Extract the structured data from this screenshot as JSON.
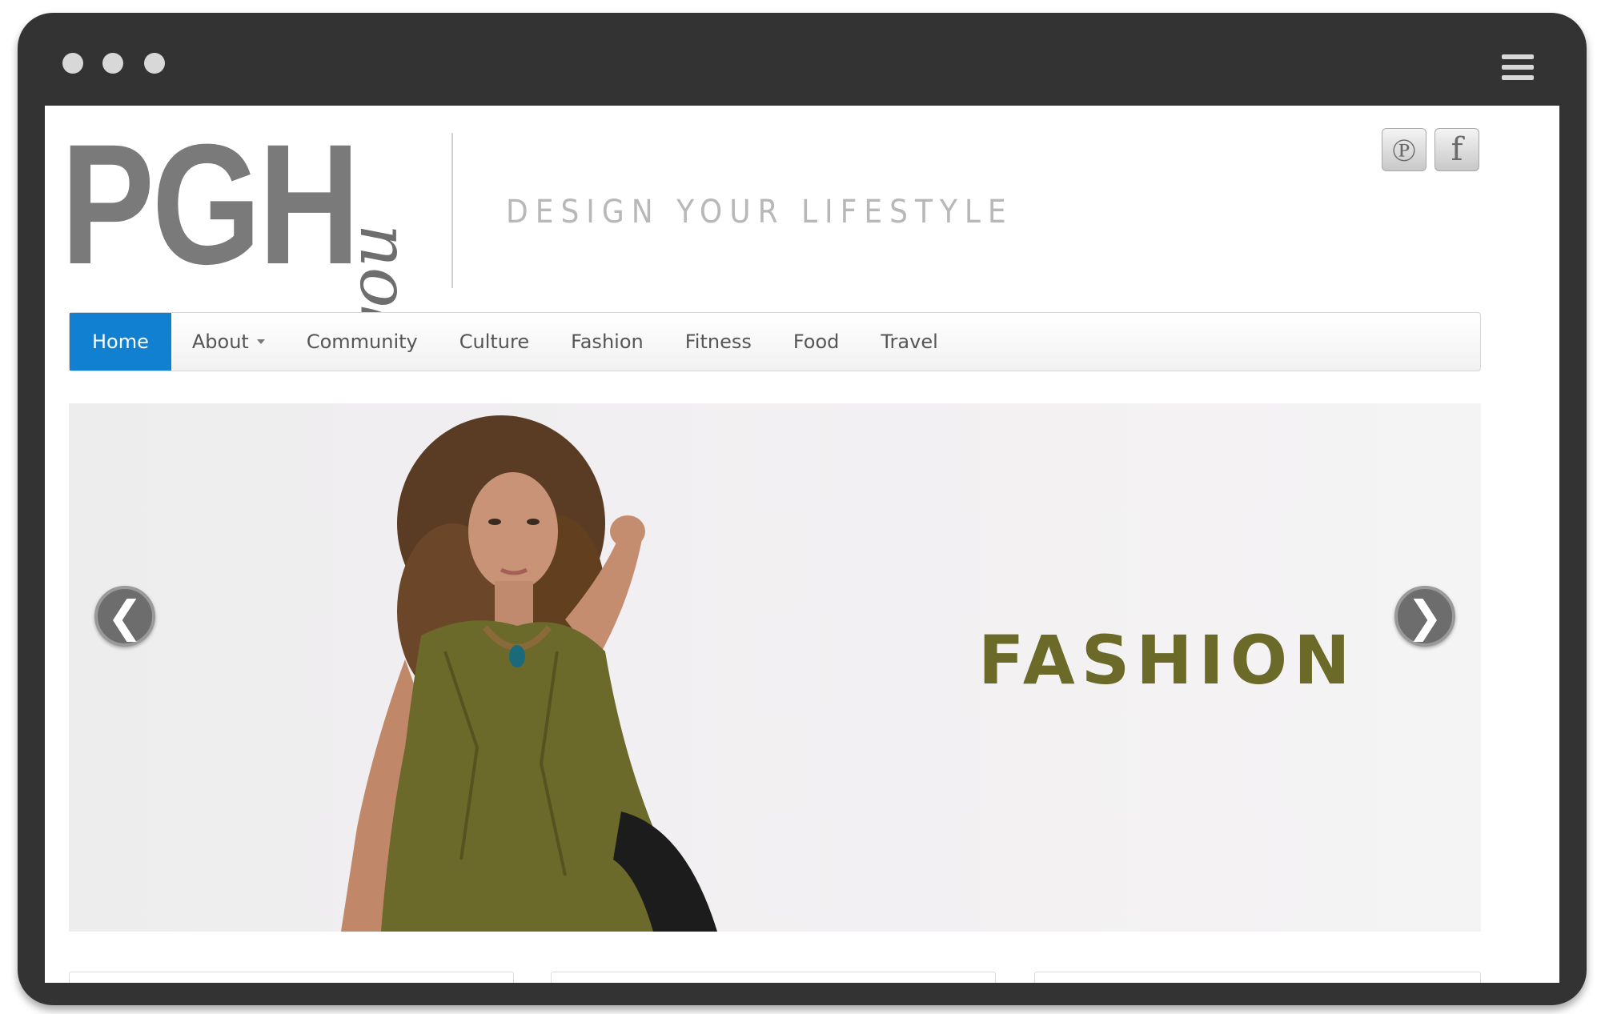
{
  "window": {
    "controls": [
      "dot",
      "dot",
      "dot"
    ],
    "menu_icon": "hamburger-menu-icon"
  },
  "header": {
    "logo_main": "PGH",
    "logo_script": "you",
    "tagline": "DESIGN YOUR LIFESTYLE",
    "social": [
      {
        "name": "pinterest-icon",
        "glyph": "℗"
      },
      {
        "name": "facebook-icon",
        "glyph": "f"
      }
    ]
  },
  "nav": {
    "items": [
      {
        "label": "Home",
        "active": true
      },
      {
        "label": "About",
        "dropdown": true
      },
      {
        "label": "Community"
      },
      {
        "label": "Culture"
      },
      {
        "label": "Fashion"
      },
      {
        "label": "Fitness"
      },
      {
        "label": "Food"
      },
      {
        "label": "Travel"
      }
    ]
  },
  "slider": {
    "title": "FASHION",
    "prev_glyph": "❮",
    "next_glyph": "❯",
    "accent_color": "#6b6a28"
  },
  "colors": {
    "nav_active": "#1180d0",
    "frame": "#333333"
  }
}
